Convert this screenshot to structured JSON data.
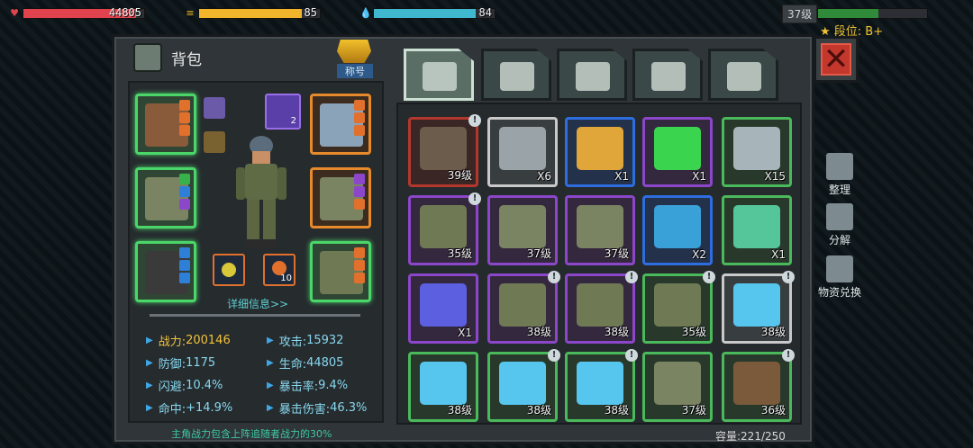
{
  "hud": {
    "hp": {
      "value": "44805",
      "fill": 0.93,
      "color": "#e0434e"
    },
    "food": {
      "value": "85",
      "fill": 0.85,
      "color": "#f0b52a"
    },
    "water": {
      "value": "84",
      "fill": 0.84,
      "color": "#3fb7cf"
    },
    "level": "37级",
    "xp_fill": 0.55,
    "rank": "段位: B+"
  },
  "backpack": {
    "title": "背包",
    "badge_label": "称号",
    "details_link": "详细信息>>",
    "note": "主角战力包含上阵追随者战力的30%",
    "stats": [
      {
        "key": "战力: ",
        "value": "200146",
        "highlight": true
      },
      {
        "key": "攻击: ",
        "value": "15932"
      },
      {
        "key": "防御: ",
        "value": "1175"
      },
      {
        "key": "生命: ",
        "value": "44805"
      },
      {
        "key": "闪避: ",
        "value": "10.4%"
      },
      {
        "key": "暴击率: ",
        "value": "9.4%"
      },
      {
        "key": "命中: ",
        "value": "+14.9%"
      },
      {
        "key": "暴击伤害: ",
        "value": "46.3%"
      }
    ],
    "mini_badge": "2",
    "mini_badge_2": "10"
  },
  "tabs": [
    "backpack-icon",
    "medkit-icon",
    "material-icon",
    "gun-icon",
    "parts-icon"
  ],
  "items": [
    {
      "name": "crossbow",
      "q": "39级",
      "border": "red",
      "color": "#6b5c4c",
      "new": true
    },
    {
      "name": "monitor",
      "q": "X6",
      "border": "white",
      "color": "#9aa3a8",
      "new": false
    },
    {
      "name": "exp-card",
      "q": "X1",
      "border": "blue",
      "color": "#e0a63a",
      "new": false
    },
    {
      "name": "green-crystal",
      "q": "X1",
      "border": "purple",
      "color": "#3bd44f",
      "new": false
    },
    {
      "name": "wrench-kit",
      "q": "X15",
      "border": "green",
      "color": "#a7b4ba",
      "new": false
    },
    {
      "name": "helmet",
      "q": "35级",
      "border": "purple",
      "color": "#6f7a55",
      "new": true
    },
    {
      "name": "vest",
      "q": "37级",
      "border": "purple",
      "color": "#7b8462",
      "new": false
    },
    {
      "name": "vest",
      "q": "37级",
      "border": "purple",
      "color": "#7b8462",
      "new": false
    },
    {
      "name": "blue-device",
      "q": "X2",
      "border": "blue",
      "color": "#3aa0d8",
      "new": false
    },
    {
      "name": "green-device",
      "q": "X1",
      "border": "green",
      "color": "#55c69a",
      "new": false
    },
    {
      "name": "blue-card",
      "q": "X1",
      "border": "purple",
      "color": "#5c5fe0",
      "new": false
    },
    {
      "name": "helmet",
      "q": "38级",
      "border": "purple",
      "color": "#6f7a55",
      "new": true
    },
    {
      "name": "helmet",
      "q": "38级",
      "border": "purple",
      "color": "#6f7a55",
      "new": true
    },
    {
      "name": "helmet",
      "q": "35级",
      "border": "green",
      "color": "#6f7a55",
      "new": true
    },
    {
      "name": "electric-blade",
      "q": "38级",
      "border": "white",
      "color": "#57c6ee",
      "new": true
    },
    {
      "name": "electric-blade",
      "q": "38级",
      "border": "green",
      "color": "#57c6ee",
      "new": false
    },
    {
      "name": "electric-blade",
      "q": "38级",
      "border": "green",
      "color": "#57c6ee",
      "new": true
    },
    {
      "name": "electric-blade",
      "q": "38级",
      "border": "green",
      "color": "#57c6ee",
      "new": true
    },
    {
      "name": "vest",
      "q": "37级",
      "border": "green",
      "color": "#7b8462",
      "new": false
    },
    {
      "name": "rifle",
      "q": "36级",
      "border": "green",
      "color": "#7a5a3a",
      "new": true
    }
  ],
  "capacity": "容量:221/250",
  "side": {
    "sort": "整理",
    "dismantle": "分解",
    "exchange": "物资兑换"
  }
}
